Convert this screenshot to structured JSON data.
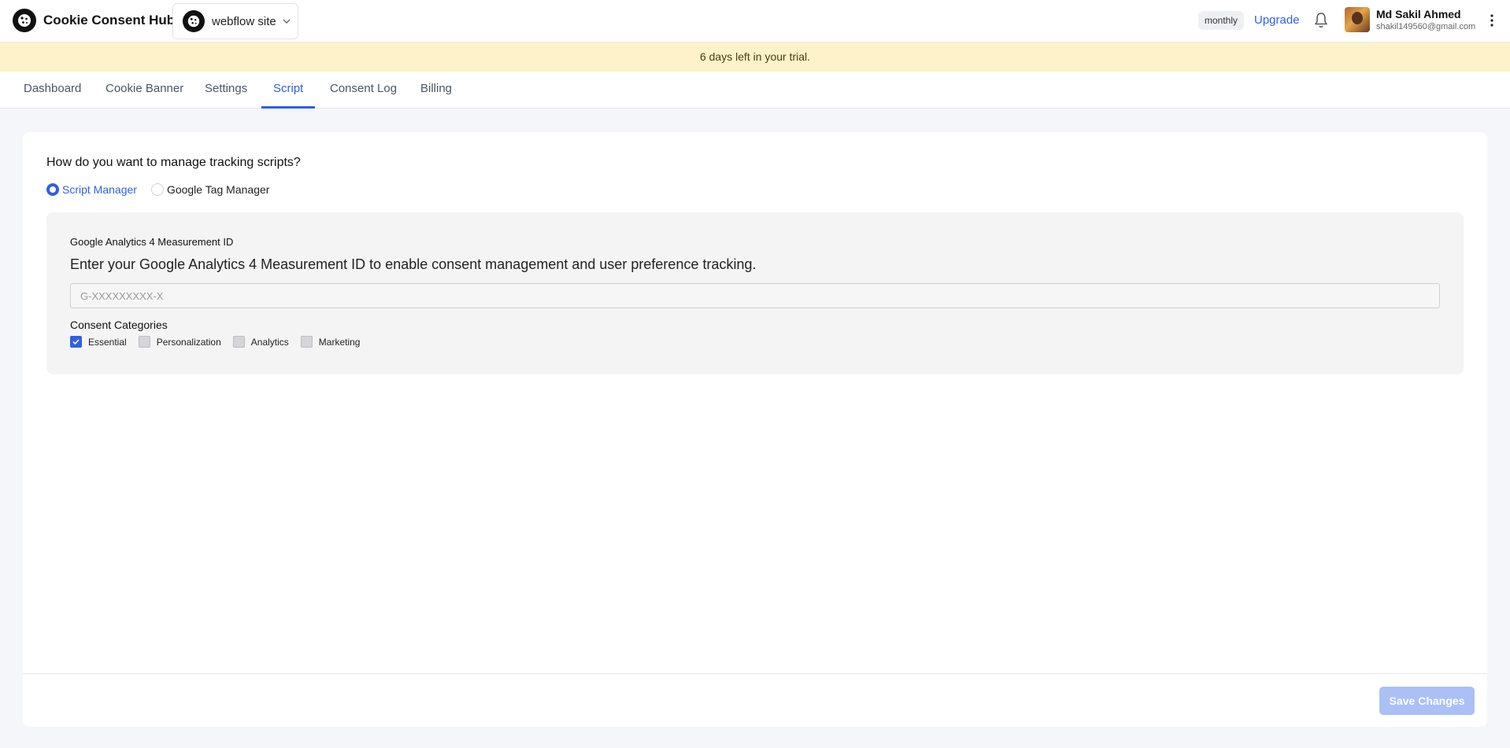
{
  "header": {
    "brand_name": "Cookie Consent Hub",
    "site_selector": {
      "value": "webflow site"
    },
    "plan_badge": "monthly",
    "upgrade_label": "Upgrade",
    "user": {
      "name": "Md Sakil Ahmed",
      "email": "shakil149560@gmail.com"
    },
    "icons": [
      "cookie-logo-icon",
      "chevron-down-icon",
      "bell-icon",
      "kebab-menu-icon"
    ]
  },
  "trial_banner": "6 days left in your trial.",
  "tabs": [
    {
      "label": "Dashboard"
    },
    {
      "label": "Cookie Banner"
    },
    {
      "label": "Settings"
    },
    {
      "label": "Script",
      "active": true
    },
    {
      "label": "Consent Log"
    },
    {
      "label": "Billing"
    }
  ],
  "script_page": {
    "question": "How do you want to manage tracking scripts?",
    "options": [
      {
        "label": "Script Manager",
        "selected": true
      },
      {
        "label": "Google Tag Manager",
        "selected": false
      }
    ],
    "ga": {
      "label": "Google Analytics 4 Measurement ID",
      "description": "Enter your Google Analytics 4 Measurement ID to enable consent management and user preference tracking.",
      "placeholder": "G-XXXXXXXXX-X",
      "value": ""
    },
    "consent": {
      "title": "Consent Categories",
      "categories": [
        {
          "label": "Essential",
          "checked": true
        },
        {
          "label": "Personalization",
          "checked": false
        },
        {
          "label": "Analytics",
          "checked": false
        },
        {
          "label": "Marketing",
          "checked": false
        }
      ]
    },
    "save_label": "Save Changes"
  },
  "colors": {
    "accent": "#2f5fe6",
    "banner_bg": "#fdf2c9",
    "save_disabled": "#aac0f7"
  }
}
